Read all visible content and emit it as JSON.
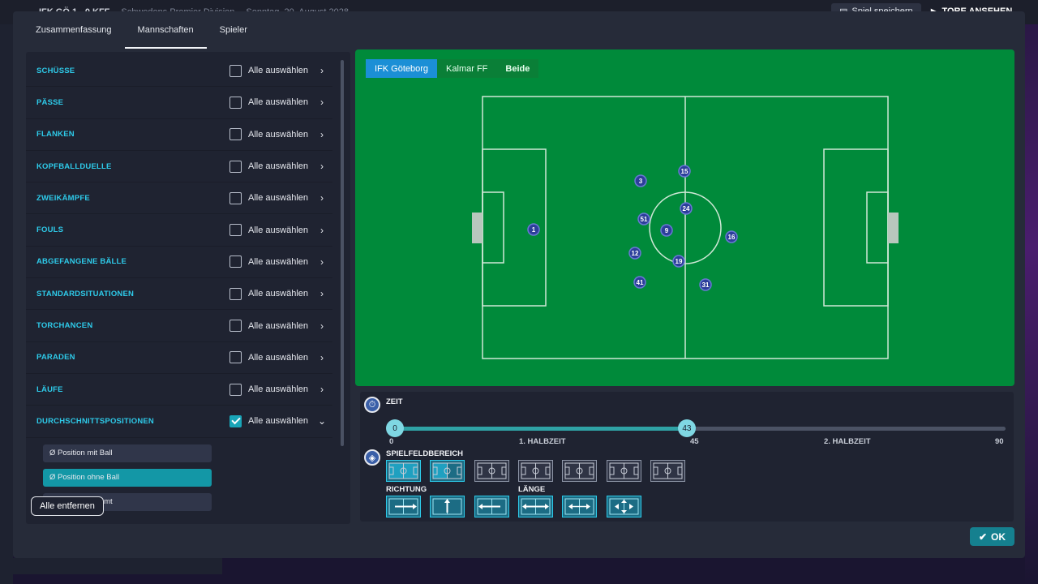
{
  "background": {
    "match_score": "IFK GÖ  1 - 0  KFF",
    "league": "Schwedens Premier Division",
    "date": "Sonntag, 20. August 2028",
    "save_label": "Spiel speichern",
    "watch_label": "TORE ANSEHEN"
  },
  "tabs": [
    {
      "label": "Zusammenfassung"
    },
    {
      "label": "Mannschaften"
    },
    {
      "label": "Spieler"
    }
  ],
  "categories": [
    {
      "label": "SCHÜSSE",
      "select_label": "Alle auswählen"
    },
    {
      "label": "PÄSSE",
      "select_label": "Alle auswählen"
    },
    {
      "label": "FLANKEN",
      "select_label": "Alle auswählen"
    },
    {
      "label": "KOPFBALLDUELLE",
      "select_label": "Alle auswählen"
    },
    {
      "label": "ZWEIKÄMPFE",
      "select_label": "Alle auswählen"
    },
    {
      "label": "FOULS",
      "select_label": "Alle auswählen"
    },
    {
      "label": "ABGEFANGENE BÄLLE",
      "select_label": "Alle auswählen"
    },
    {
      "label": "STANDARDSITUATIONEN",
      "select_label": "Alle auswählen"
    },
    {
      "label": "TORCHANCEN",
      "select_label": "Alle auswählen"
    },
    {
      "label": "PARADEN",
      "select_label": "Alle auswählen"
    },
    {
      "label": "LÄUFE",
      "select_label": "Alle auswählen"
    },
    {
      "label": "DURCHSCHNITTSPOSITIONEN",
      "select_label": "Alle auswählen"
    }
  ],
  "sub_items": [
    {
      "label": "Ø Position mit Ball"
    },
    {
      "label": "Ø Position ohne Ball"
    },
    {
      "label": "Ø Position gesamt"
    }
  ],
  "remove_all_label": "Alle entfernen",
  "team_tabs": [
    {
      "label": "IFK Göteborg"
    },
    {
      "label": "Kalmar FF"
    },
    {
      "label": "Beide"
    }
  ],
  "players": [
    "1",
    "3",
    "15",
    "24",
    "51",
    "9",
    "16",
    "12",
    "19",
    "41",
    "31"
  ],
  "time": {
    "label": "ZEIT",
    "start_value": "0",
    "current_value": "43",
    "current_fraction": 0.478,
    "ticks": [
      "0",
      "1. HALBZEIT",
      "45",
      "2. HALBZEIT",
      "90"
    ]
  },
  "area_label": "SPIELFELDBEREICH",
  "direction_label": "RICHTUNG",
  "length_label": "LÄNGE",
  "ok_label": "OK",
  "colors": {
    "accent": "#2ecbea",
    "pitch": "#008a3a",
    "selected_team": "#1b8fd6",
    "ok_button": "#15808f"
  }
}
